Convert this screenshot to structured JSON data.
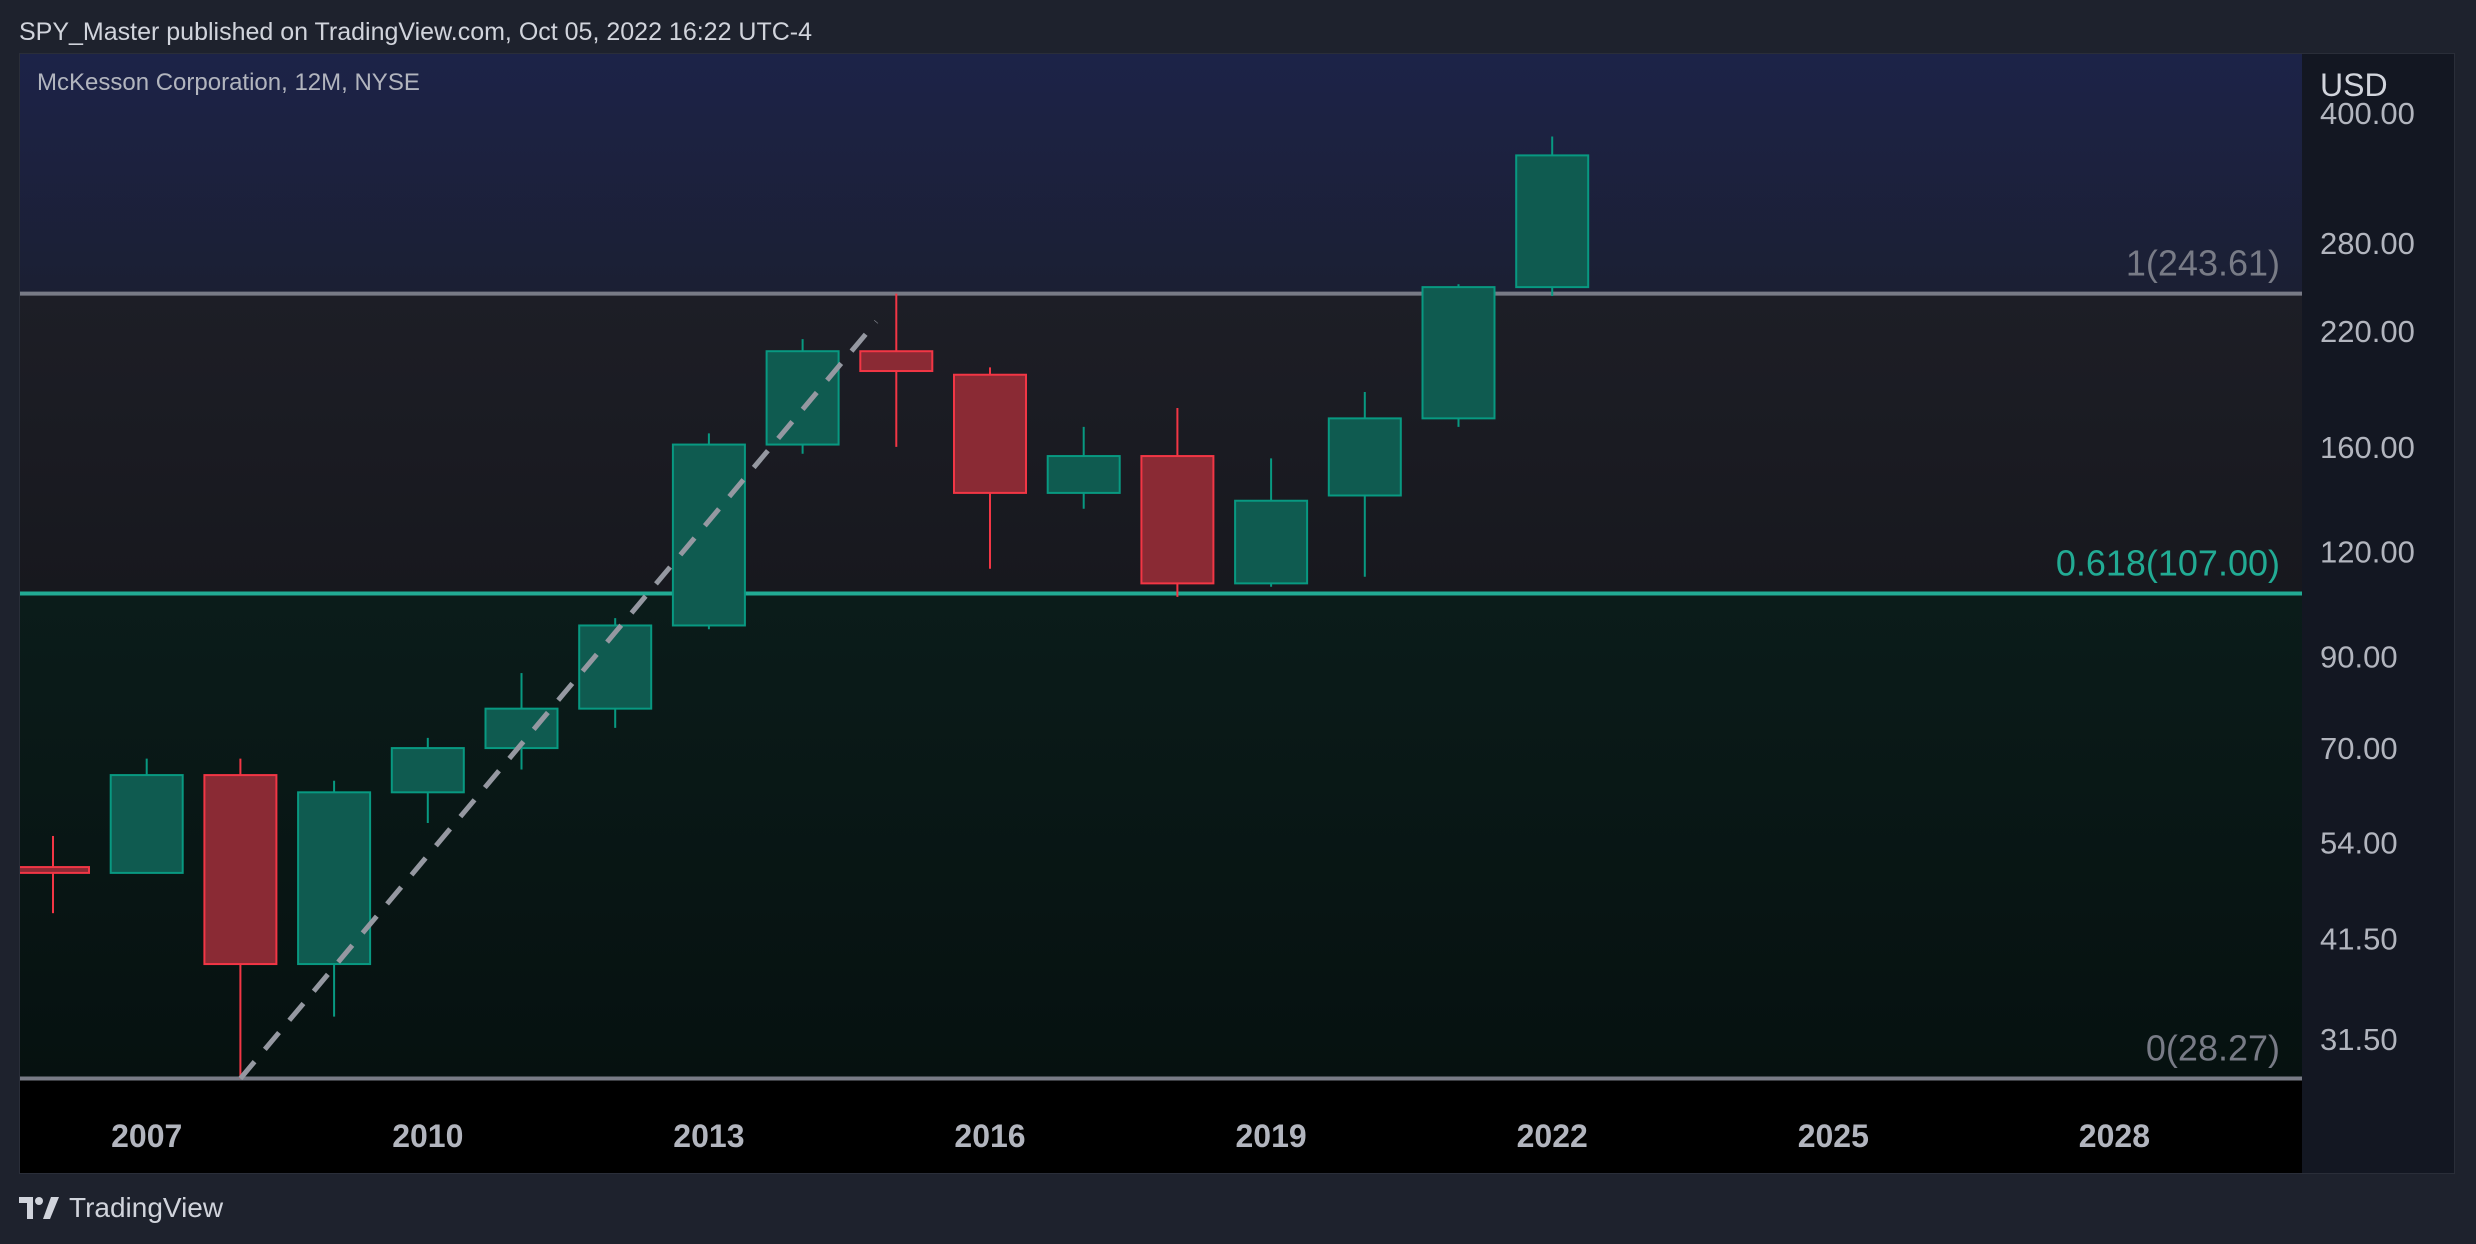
{
  "header": {
    "published_line": "SPY_Master published on TradingView.com, Oct 05, 2022 16:22 UTC-4"
  },
  "chart": {
    "symbol_title": "McKesson Corporation, 12M, NYSE"
  },
  "footer": {
    "brand": "TradingView",
    "logo_icon": "tradingview-logo-icon"
  },
  "colors": {
    "up": "#089981",
    "down": "#f23645",
    "up_body": "#0f5b50",
    "down_body": "#8a2a34",
    "fib_line": "#787b86",
    "fib_618": "#22ab94",
    "axis_text": "#b2b5be",
    "zone_top": "#1c2348",
    "zone_mid": "#1c1d24",
    "zone_bottom": "#061412"
  },
  "chart_data": {
    "type": "candlestick",
    "scale": "log",
    "y_unit": "USD",
    "ylim": [
      26,
      450
    ],
    "xlim": [
      2006,
      2030
    ],
    "x_ticks": [
      "2007",
      "2010",
      "2013",
      "2016",
      "2019",
      "2022",
      "2025",
      "2028"
    ],
    "y_ticks": [
      "400.00",
      "280.00",
      "220.00",
      "160.00",
      "120.00",
      "90.00",
      "70.00",
      "54.00",
      "41.50",
      "31.50"
    ],
    "candles": [
      {
        "year": 2006,
        "open": 50.5,
        "high": 55.0,
        "low": 44.5,
        "close": 49.7
      },
      {
        "year": 2007,
        "open": 49.7,
        "high": 68.0,
        "low": 49.7,
        "close": 65.0
      },
      {
        "year": 2008,
        "open": 65.0,
        "high": 68.0,
        "low": 28.27,
        "close": 38.7
      },
      {
        "year": 2009,
        "open": 38.7,
        "high": 64.0,
        "low": 33.5,
        "close": 62.0
      },
      {
        "year": 2010,
        "open": 62.0,
        "high": 72.0,
        "low": 57.0,
        "close": 70.0
      },
      {
        "year": 2011,
        "open": 70.0,
        "high": 86.0,
        "low": 66.0,
        "close": 78.0
      },
      {
        "year": 2012,
        "open": 78.0,
        "high": 100.0,
        "low": 74.0,
        "close": 98.0
      },
      {
        "year": 2013,
        "open": 98.0,
        "high": 166.0,
        "low": 97.0,
        "close": 161.0
      },
      {
        "year": 2014,
        "open": 161.0,
        "high": 215.0,
        "low": 157.0,
        "close": 208.0
      },
      {
        "year": 2015,
        "open": 208.0,
        "high": 243.61,
        "low": 160.0,
        "close": 197.0
      },
      {
        "year": 2016,
        "open": 195.0,
        "high": 199.0,
        "low": 114.5,
        "close": 141.0
      },
      {
        "year": 2017,
        "open": 141.0,
        "high": 169.0,
        "low": 135.0,
        "close": 156.0
      },
      {
        "year": 2018,
        "open": 156.0,
        "high": 178.0,
        "low": 106.0,
        "close": 110.0
      },
      {
        "year": 2019,
        "open": 110.0,
        "high": 155.0,
        "low": 109.0,
        "close": 138.0
      },
      {
        "year": 2020,
        "open": 140.0,
        "high": 186.0,
        "low": 112.0,
        "close": 173.0
      },
      {
        "year": 2021,
        "open": 173.0,
        "high": 250.0,
        "low": 169.0,
        "close": 248.0
      },
      {
        "year": 2022,
        "open": 248.0,
        "high": 375.0,
        "low": 242.0,
        "close": 356.0
      }
    ],
    "fib_levels": [
      {
        "ratio": 1,
        "price": 243.61,
        "label": "1(243.61)"
      },
      {
        "ratio": 0.618,
        "price": 107.0,
        "label": "0.618(107.00)"
      },
      {
        "ratio": 0,
        "price": 28.27,
        "label": "0(28.27)"
      }
    ],
    "trend_line": {
      "from": {
        "year": 2008,
        "price": 28.27
      },
      "to": {
        "year": 2015,
        "price": 243.61
      },
      "style": "dashed"
    }
  }
}
